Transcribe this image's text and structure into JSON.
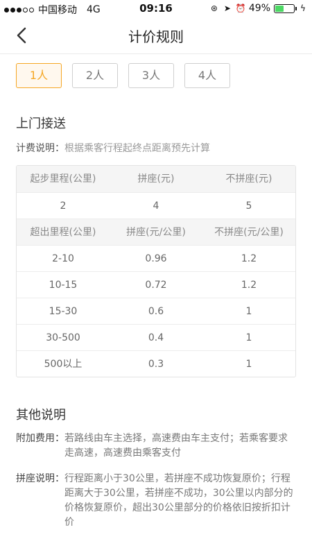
{
  "status_bar": {
    "carrier": "中国移动",
    "network": "4G",
    "time": "09:16",
    "battery": "49%",
    "battery_level": 0.49,
    "battery_color": "#4cd964"
  },
  "nav": {
    "title": "计价规则",
    "back_icon": "chevron-left-icon"
  },
  "tabs": [
    {
      "label": "1人",
      "active": true
    },
    {
      "label": "2人",
      "active": false
    },
    {
      "label": "3人",
      "active": false
    },
    {
      "label": "4人",
      "active": false
    }
  ],
  "accent_color": "#f5a623",
  "section1": {
    "title": "上门接送",
    "desc_label": "计费说明：",
    "desc_text": "根据乘客行程起终点距离预先计算"
  },
  "table": {
    "base_header": [
      "起步里程(公里)",
      "拼座(元)",
      "不拼座(元)"
    ],
    "base_row": [
      "2",
      "4",
      "5"
    ],
    "extra_header": [
      "超出里程(公里)",
      "拼座(元/公里)",
      "不拼座(元/公里)"
    ],
    "extra_rows": [
      [
        "2-10",
        "0.96",
        "1.2"
      ],
      [
        "10-15",
        "0.72",
        "1.2"
      ],
      [
        "15-30",
        "0.6",
        "1"
      ],
      [
        "30-500",
        "0.4",
        "1"
      ],
      [
        "500以上",
        "0.3",
        "1"
      ]
    ]
  },
  "section2": {
    "title": "其他说明",
    "items": [
      {
        "label": "附加费用：",
        "text": "若路线由车主选择，高速费由车主支付；若乘客要求走高速，高速费由乘客支付"
      },
      {
        "label": "拼座说明：",
        "text": "行程距离小于30公里，若拼座不成功恢复原价；行程距离大于30公里，若拼座不成功，30公里以内部分的价格恢复原价，超出30公里部分的价格依旧按折扣计价"
      }
    ]
  }
}
